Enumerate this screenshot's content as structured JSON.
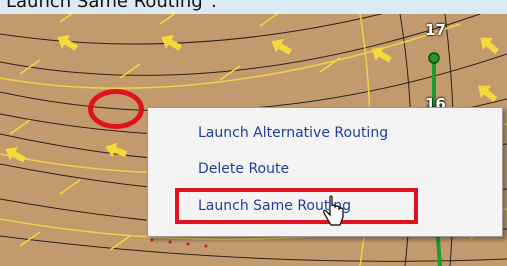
{
  "caption": {
    "text": "Launch Same Routing\"."
  },
  "map": {
    "background_color": "#c29a6e",
    "isoline_color": "#f1d24a",
    "arrow_color": "#f6d83a",
    "route_color": "#1f9a2e",
    "markers": [
      {
        "label": "17"
      },
      {
        "label": "16"
      }
    ]
  },
  "context_menu": {
    "items": [
      {
        "label": "Launch Alternative Routing"
      },
      {
        "label": "Delete Route"
      },
      {
        "label": "Launch Same Routing"
      }
    ]
  },
  "annotations": {
    "highlight_color": "#e0121f"
  },
  "icons": {
    "cursor": "hand-pointer-icon",
    "wind_arrow": "arrow-icon",
    "waypoint": "waypoint-icon"
  }
}
